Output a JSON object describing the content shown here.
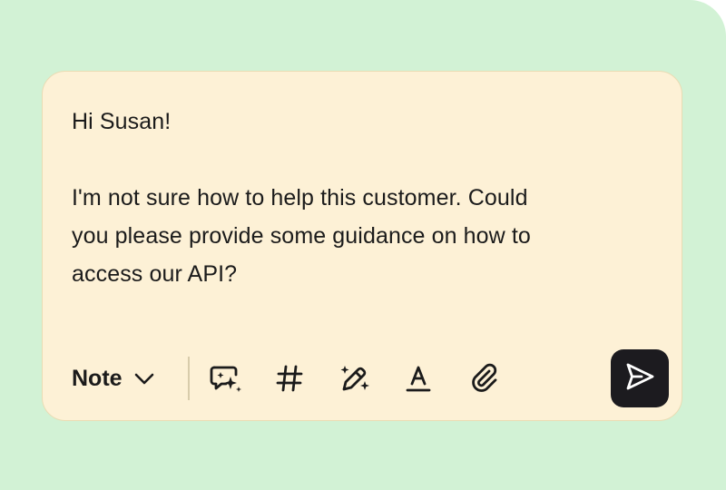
{
  "composer": {
    "message_lines": [
      "Hi Susan!",
      "",
      "I'm not sure how to help this customer. Could",
      "you please provide some guidance on how to",
      "access our API?"
    ]
  },
  "toolbar": {
    "mode_label": "Note",
    "tools": [
      {
        "name": "ai-reply-icon"
      },
      {
        "name": "hashtag-icon"
      },
      {
        "name": "magic-pen-icon"
      },
      {
        "name": "text-format-icon"
      },
      {
        "name": "paperclip-icon"
      }
    ],
    "send_icon": "send-icon"
  },
  "colors": {
    "backdrop": "#d2f2d5",
    "composer_bg": "#fdf1d6",
    "send_bg": "#1c1b1f",
    "text": "#1b1b1b"
  }
}
